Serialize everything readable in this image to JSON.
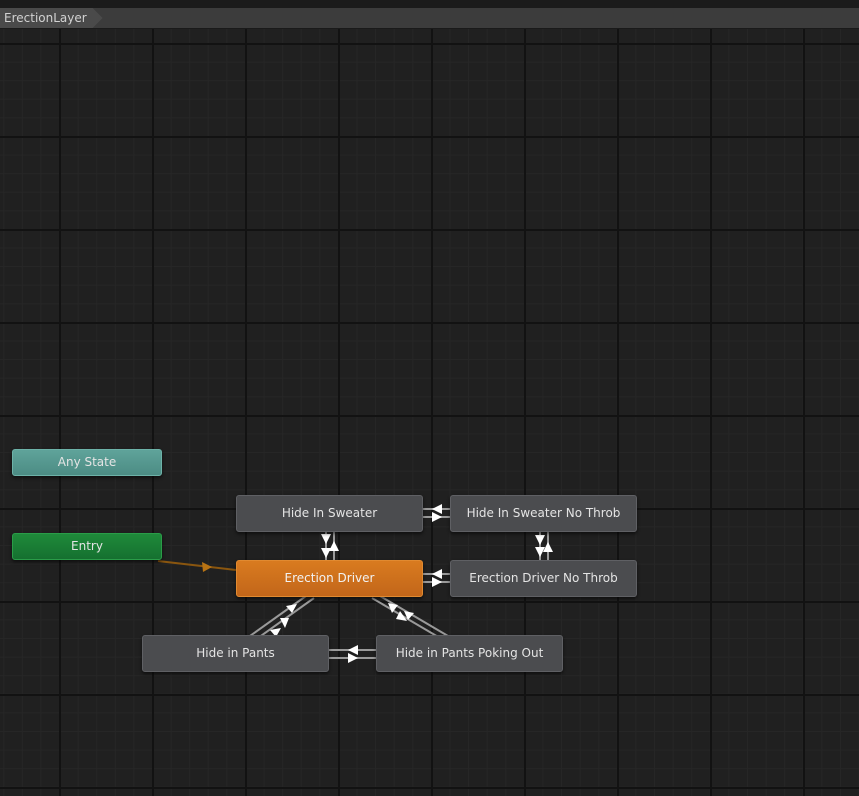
{
  "breadcrumb": {
    "layer": "ErectionLayer"
  },
  "colors": {
    "canvas": "#202020",
    "default_state": "#d2721d",
    "state": "#4b4c4f",
    "any_state": "#5a9d94",
    "entry": "#1a7d36",
    "entry_transition": "#a0620f",
    "transition_line": "#9a9a9a"
  },
  "states": {
    "any_state": "Any State",
    "entry": "Entry",
    "hide_in_sweater": "Hide In Sweater",
    "hide_in_sweater_no_throb": "Hide In Sweater No Throb",
    "erection_driver": "Erection Driver",
    "erection_driver_no_throb": "Erection Driver No Throb",
    "hide_in_pants": "Hide in Pants",
    "hide_in_pants_poking_out": "Hide in Pants Poking Out"
  },
  "default_state": "Erection Driver"
}
